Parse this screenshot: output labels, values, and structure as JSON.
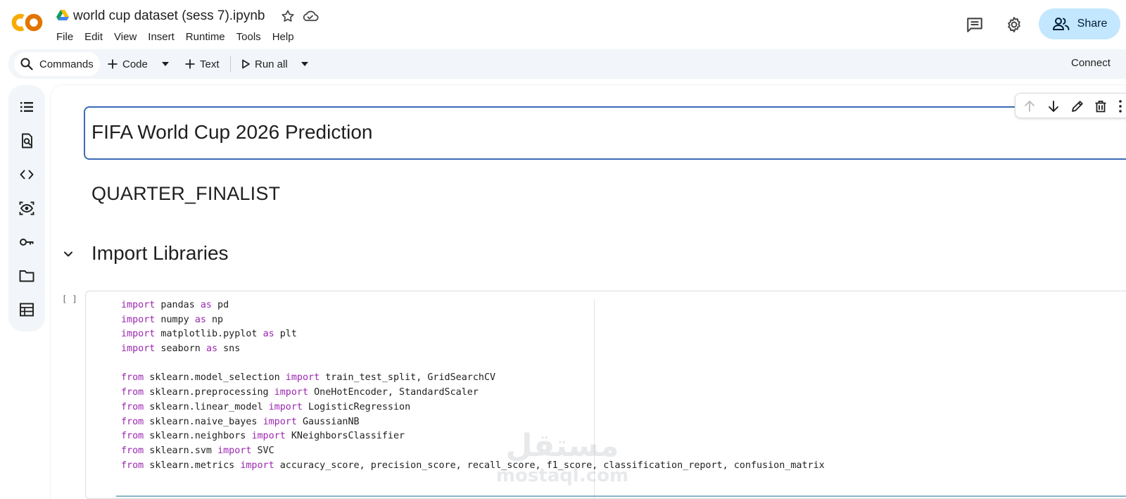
{
  "header": {
    "title": "world cup dataset (sess 7).ipynb",
    "logo_text": "CO",
    "menu": [
      "File",
      "Edit",
      "View",
      "Insert",
      "Runtime",
      "Tools",
      "Help"
    ],
    "share_label": "Share"
  },
  "toolbar": {
    "commands_label": "Commands",
    "code_label": "Code",
    "text_label": "Text",
    "run_all_label": "Run all",
    "connect_label": "Connect"
  },
  "sidebar": {
    "icons": [
      "table-of-contents-icon",
      "find-replace-icon",
      "code-snippets-icon",
      "variables-icon",
      "secrets-key-icon",
      "files-folder-icon",
      "data-table-icon"
    ]
  },
  "cells": {
    "title": "FIFA World Cup 2026 Prediction",
    "subtitle": "QUARTER_FINALIST",
    "section_heading": "Import Libraries",
    "run_indicator": "[ ]"
  },
  "code_lines": [
    [
      {
        "t": "import",
        "k": true
      },
      {
        "t": " pandas "
      },
      {
        "t": "as",
        "k": true
      },
      {
        "t": " pd"
      }
    ],
    [
      {
        "t": "import",
        "k": true
      },
      {
        "t": " numpy "
      },
      {
        "t": "as",
        "k": true
      },
      {
        "t": " np"
      }
    ],
    [
      {
        "t": "import",
        "k": true
      },
      {
        "t": " matplotlib.pyplot "
      },
      {
        "t": "as",
        "k": true
      },
      {
        "t": " plt"
      }
    ],
    [
      {
        "t": "import",
        "k": true
      },
      {
        "t": " seaborn "
      },
      {
        "t": "as",
        "k": true
      },
      {
        "t": " sns"
      }
    ],
    [],
    [
      {
        "t": "from",
        "k": true
      },
      {
        "t": " sklearn.model_selection "
      },
      {
        "t": "import",
        "k": true
      },
      {
        "t": " train_test_split, GridSearchCV"
      }
    ],
    [
      {
        "t": "from",
        "k": true
      },
      {
        "t": " sklearn.preprocessing "
      },
      {
        "t": "import",
        "k": true
      },
      {
        "t": " OneHotEncoder, StandardScaler"
      }
    ],
    [
      {
        "t": "from",
        "k": true
      },
      {
        "t": " sklearn.linear_model "
      },
      {
        "t": "import",
        "k": true
      },
      {
        "t": " LogisticRegression"
      }
    ],
    [
      {
        "t": "from",
        "k": true
      },
      {
        "t": " sklearn.naive_bayes "
      },
      {
        "t": "import",
        "k": true
      },
      {
        "t": " GaussianNB"
      }
    ],
    [
      {
        "t": "from",
        "k": true
      },
      {
        "t": " sklearn.neighbors "
      },
      {
        "t": "import",
        "k": true
      },
      {
        "t": " KNeighborsClassifier"
      }
    ],
    [
      {
        "t": "from",
        "k": true
      },
      {
        "t": " sklearn.svm "
      },
      {
        "t": "import",
        "k": true
      },
      {
        "t": " SVC"
      }
    ],
    [
      {
        "t": "from",
        "k": true
      },
      {
        "t": " sklearn.metrics "
      },
      {
        "t": "import",
        "k": true
      },
      {
        "t": " accuracy_score, precision_score, recall_score, f1_score, classification_report, confusion_matrix"
      }
    ]
  ],
  "watermark": {
    "arabic": "مستقل",
    "latin": "mostaql.com"
  },
  "colors": {
    "keyword": "#9c27b0",
    "selected_border": "#3b6bb5",
    "share_bg": "#c2e7ff",
    "logo_orange": "#f9ab00",
    "logo_dark_orange": "#e37400"
  }
}
